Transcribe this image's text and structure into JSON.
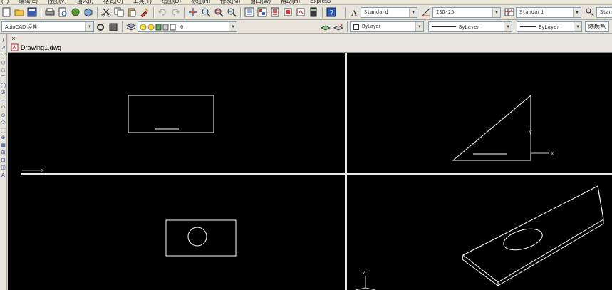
{
  "menu": [
    "(F)",
    "编辑(E)",
    "视图(V)",
    "插入(I)",
    "格式(O)",
    "工具(T)",
    "绘图(D)",
    "标注(N)",
    "修改(M)",
    "窗口(W)",
    "帮助(H)",
    "Express"
  ],
  "toolbar1": {
    "text_style": "Standard",
    "dim_style": "ISO-25",
    "table_style": "Standard",
    "truncated": "Stan"
  },
  "toolbar2": {
    "workspace": "AutoCAD 经典",
    "layer": "0",
    "color": "ByLayer",
    "linetype": "ByLayer",
    "lineweight": "ByLayer",
    "plot_style": "随颜色"
  },
  "document": {
    "title": "Drawing1.dwg",
    "close_symbol": "×"
  },
  "viewports": {
    "top_right_axis_y": "Y",
    "top_right_axis_x": "X",
    "bottom_right_axis_z": "Z"
  },
  "left_tools": [
    "/",
    "↗",
    "⌒",
    "⬡",
    "□",
    "⌒",
    "◯",
    "ℬ",
    "∽",
    "◠",
    "⊙",
    "⬭",
    "⬚",
    "⊕",
    "▦",
    "⊞",
    "⊡",
    "◫",
    "A"
  ],
  "colors": {
    "canvas": "#000000",
    "line": "#ffffff",
    "toolbar": "#e7e4dc"
  }
}
